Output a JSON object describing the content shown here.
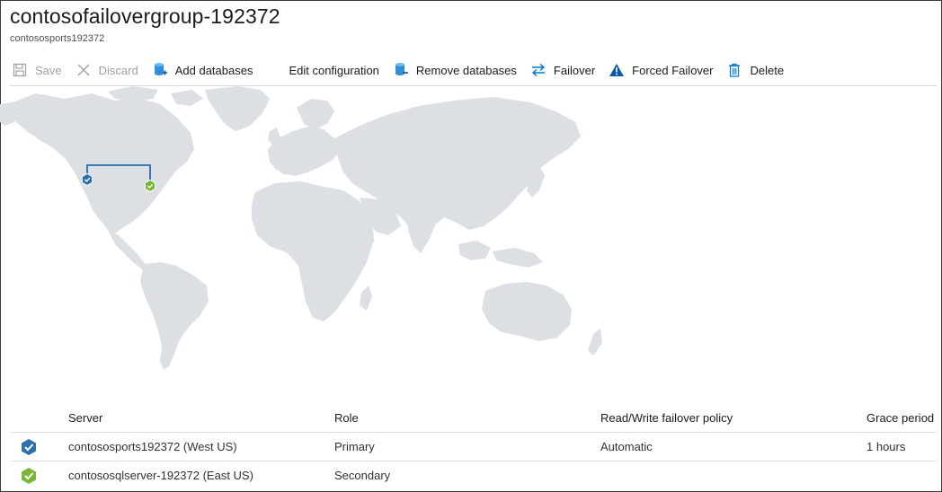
{
  "header": {
    "title": "contosofailovergroup-192372",
    "subtitle": "contososports192372"
  },
  "toolbar": {
    "save": {
      "label": "Save",
      "icon": "save-icon"
    },
    "discard": {
      "label": "Discard",
      "icon": "close-icon"
    },
    "add_databases": {
      "label": "Add databases",
      "icon": "database-add-icon"
    },
    "edit_configuration": {
      "label": "Edit configuration"
    },
    "remove_databases": {
      "label": "Remove databases",
      "icon": "database-remove-icon"
    },
    "failover": {
      "label": "Failover",
      "icon": "swap-arrows-icon"
    },
    "forced_failover": {
      "label": "Forced Failover",
      "icon": "warning-icon"
    },
    "delete": {
      "label": "Delete",
      "icon": "trash-icon"
    }
  },
  "colors": {
    "accent": "#0078d4",
    "primary_marker": "#2e6fac",
    "secondary_marker": "#7ab738",
    "map_land": "#dcdfe3",
    "connection_line": "#3a76b0"
  },
  "table": {
    "headers": {
      "server": "Server",
      "role": "Role",
      "policy": "Read/Write failover policy",
      "grace": "Grace period"
    },
    "rows": [
      {
        "icon": "primary-check-icon",
        "server": "contososports192372 (West US)",
        "role": "Primary",
        "policy": "Automatic",
        "grace": "1 hours"
      },
      {
        "icon": "secondary-check-icon",
        "server": "contososqlserver-192372 (East US)",
        "role": "Secondary",
        "policy": "",
        "grace": ""
      }
    ]
  }
}
